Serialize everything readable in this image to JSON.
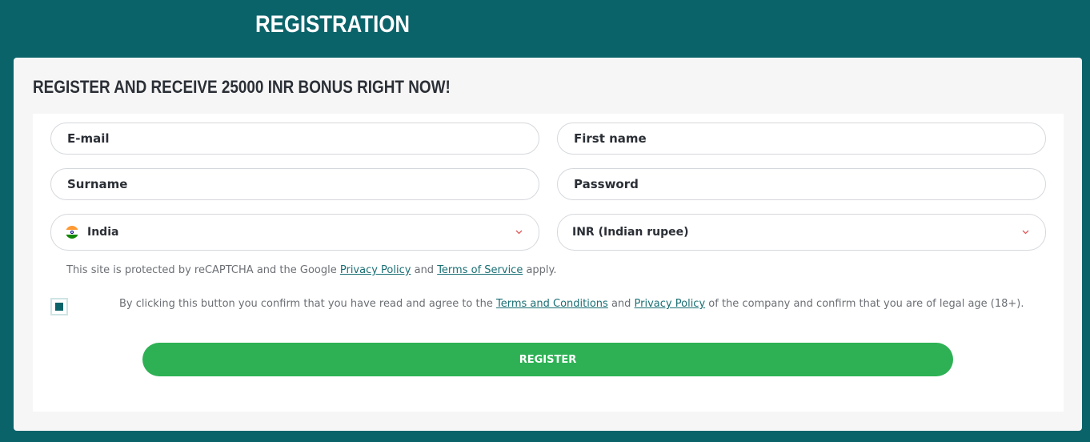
{
  "header": {
    "title": "REGISTRATION"
  },
  "promo": {
    "text": "REGISTER AND RECEIVE 25000 INR BONUS RIGHT NOW!"
  },
  "form": {
    "email_placeholder": "E-mail",
    "first_name_placeholder": "First name",
    "surname_placeholder": "Surname",
    "password_placeholder": "Password",
    "country": {
      "value": "India",
      "flag": "india-flag-icon"
    },
    "currency": {
      "value": "INR (Indian rupee)"
    }
  },
  "recaptcha": {
    "prefix": "This site is protected by reCAPTCHA and the Google ",
    "privacy_link": "Privacy Policy",
    "and": " and ",
    "terms_link": "Terms of Service",
    "suffix": " apply."
  },
  "agreement": {
    "checked": true,
    "prefix": "By clicking this button you confirm that you have read and agree to the ",
    "terms_link": "Terms and Conditions",
    "and": " and ",
    "privacy_link": "Privacy Policy",
    "suffix": " of the company and confirm that you are of legal age (18+)."
  },
  "register_button": {
    "label": "REGISTER"
  },
  "colors": {
    "background": "#0b636a",
    "button": "#2db154",
    "link": "#1a6f74",
    "chevron": "#e05a5a"
  }
}
